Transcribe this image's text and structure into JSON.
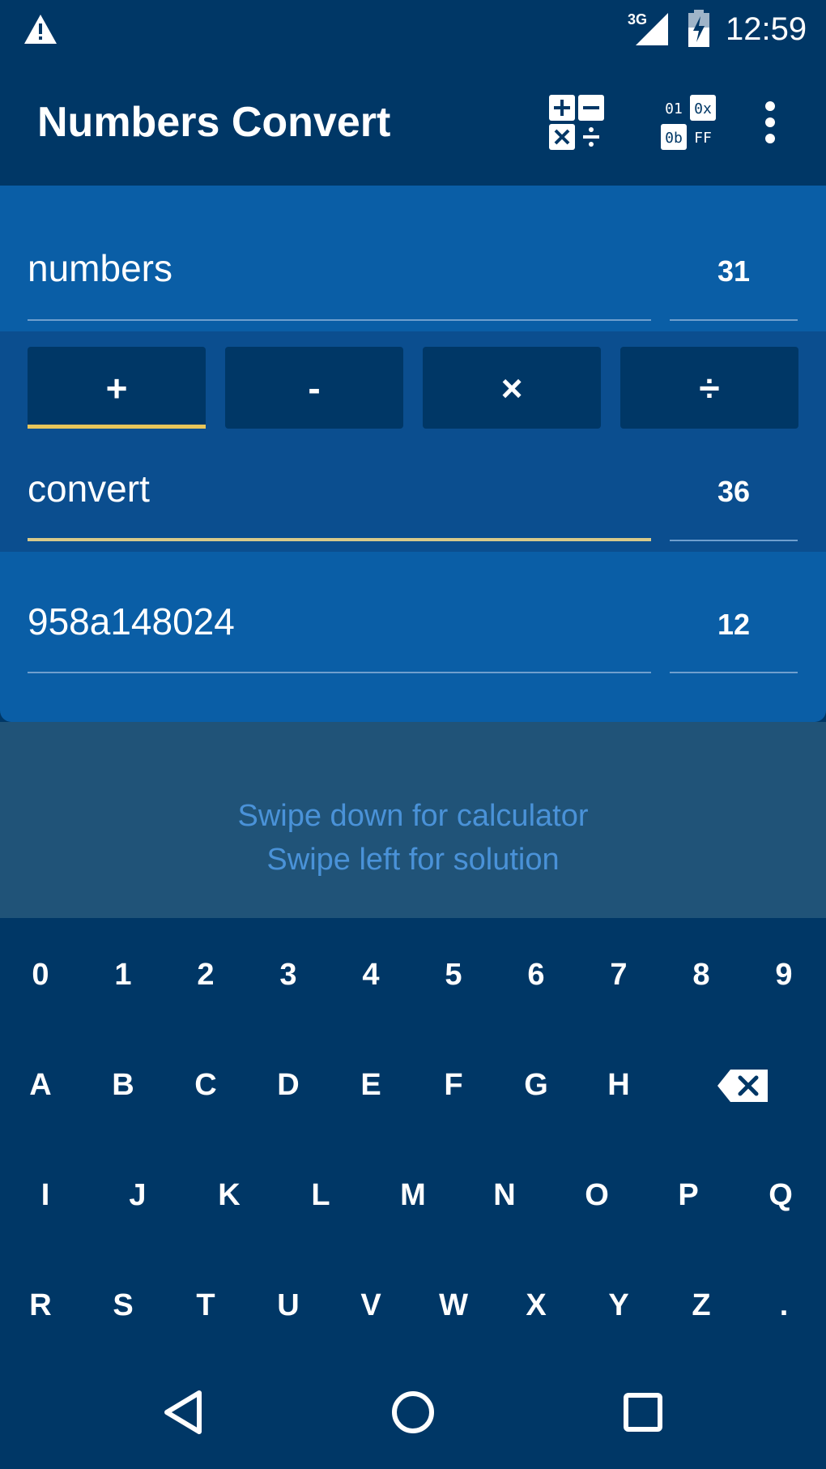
{
  "status_bar": {
    "network": "3G",
    "time": "12:59",
    "icons": [
      "warning-icon",
      "signal-icon",
      "battery-charging-icon"
    ]
  },
  "app_bar": {
    "title": "Numbers Convert",
    "actions": [
      "calculator-icon",
      "base-converter-icon",
      "more-options-icon"
    ],
    "converter_icon_text": [
      "01",
      "0x",
      "0b",
      "FF"
    ]
  },
  "inputs": {
    "first": {
      "value": "numbers",
      "base": "31"
    },
    "second": {
      "value": "convert",
      "base": "36"
    },
    "result": {
      "value": "958a148024",
      "base": "12"
    }
  },
  "operators": {
    "items": [
      "+",
      "-",
      "×",
      "÷"
    ],
    "selected": "+"
  },
  "hints": {
    "line1": "Swipe down for calculator",
    "line2": "Swipe left for solution"
  },
  "keyboard": {
    "row1": [
      "0",
      "1",
      "2",
      "3",
      "4",
      "5",
      "6",
      "7",
      "8",
      "9"
    ],
    "row2": [
      "A",
      "B",
      "C",
      "D",
      "E",
      "F",
      "G",
      "H"
    ],
    "row3": [
      "I",
      "J",
      "K",
      "L",
      "M",
      "N",
      "O",
      "P",
      "Q"
    ],
    "row4": [
      "R",
      "S",
      "T",
      "U",
      "V",
      "W",
      "X",
      "Y",
      "Z",
      "."
    ],
    "backspace_icon": "backspace-icon"
  },
  "nav_bar": {
    "icons": [
      "back-icon",
      "home-icon",
      "recents-icon"
    ]
  },
  "colors": {
    "primary_dark": "#003766",
    "card": "#0a5ea6",
    "accent": "#e8c55a",
    "hint_text": "#4a92d8"
  }
}
